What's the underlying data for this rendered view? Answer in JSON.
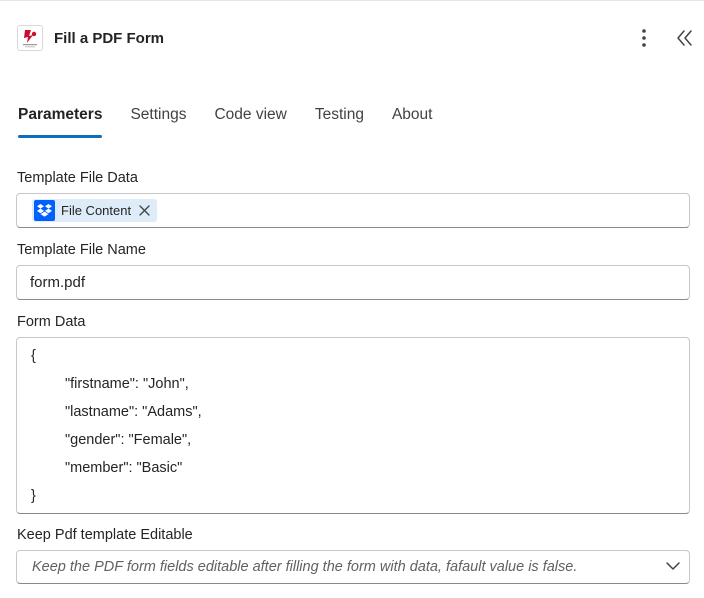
{
  "header": {
    "title": "Fill a PDF Form",
    "logo_icon": "pdf-form-logo",
    "more_icon": "more-vertical-icon",
    "collapse_icon": "chevron-double-left-icon"
  },
  "tabs": [
    {
      "label": "Parameters",
      "active": true
    },
    {
      "label": "Settings",
      "active": false
    },
    {
      "label": "Code view",
      "active": false
    },
    {
      "label": "Testing",
      "active": false
    },
    {
      "label": "About",
      "active": false
    }
  ],
  "fields": {
    "template_file_data": {
      "label": "Template File Data",
      "token_label": "File Content",
      "token_icon": "dropbox-icon"
    },
    "template_file_name": {
      "label": "Template File Name",
      "value": "form.pdf"
    },
    "form_data": {
      "label": "Form Data",
      "lines": [
        "{",
        "\"firstname\": \"John\",",
        "\"lastname\": \"Adams\",",
        "\"gender\": \"Female\",",
        "\"member\": \"Basic\"",
        "}"
      ]
    },
    "keep_editable": {
      "label": "Keep Pdf template Editable",
      "placeholder": "Keep the PDF form fields editable after filling the form with data, fafault value is false."
    }
  },
  "colors": {
    "accent": "#0f6cbd",
    "token_bg": "#deecf9",
    "dropbox_blue": "#0061fe"
  }
}
